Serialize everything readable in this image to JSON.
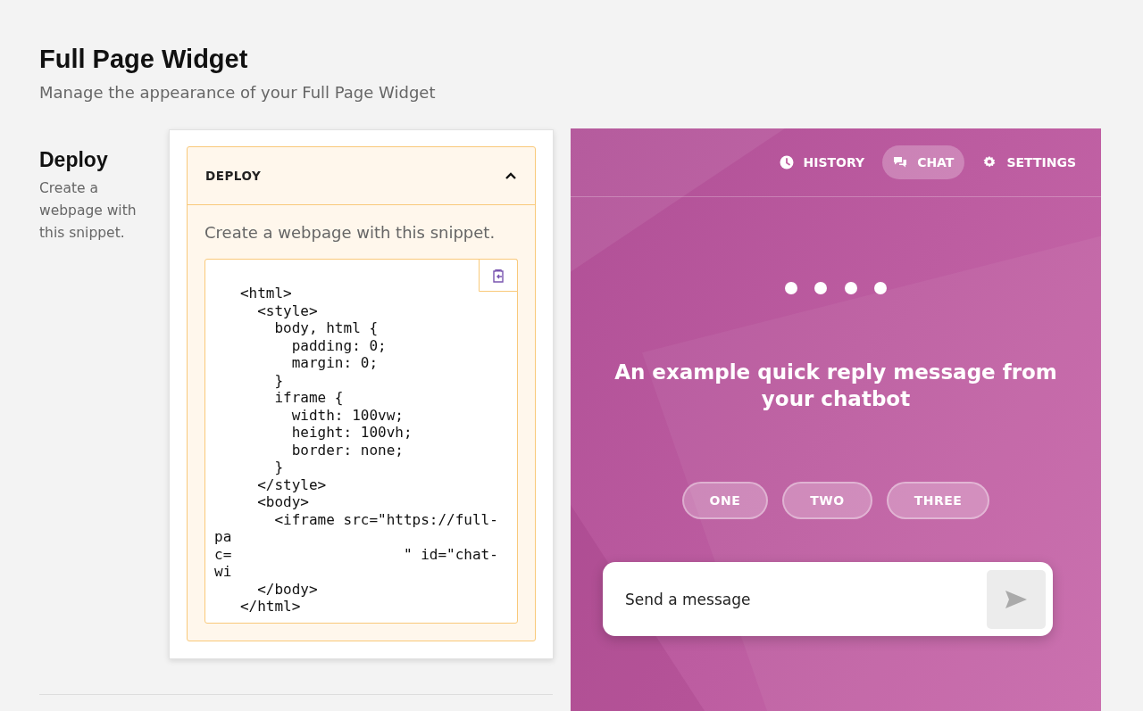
{
  "page": {
    "title": "Full Page Widget",
    "subtitle": "Manage the appearance of your Full Page Widget"
  },
  "section": {
    "title": "Deploy",
    "description": "Create a webpage with this snippet."
  },
  "accordion": {
    "title": "DEPLOY",
    "expanded": true,
    "description": "Create a webpage with this snippet.",
    "code_lines": [
      "   <html>",
      "     <style>",
      "       body, html {",
      "         padding: 0;",
      "         margin: 0;",
      "       }",
      "       iframe {",
      "         width: 100vw;",
      "         height: 100vh;",
      "         border: none;",
      "       }",
      "     </style>",
      "     <body>",
      "       <iframe src=\"https://full-",
      "pa",
      "c=                    \" id=\"chat-",
      "wi",
      "     </body>",
      "   </html>"
    ]
  },
  "preview": {
    "nav": [
      {
        "label": "HISTORY",
        "kind": "clock",
        "selected": false
      },
      {
        "label": "CHAT",
        "kind": "chat",
        "selected": true
      },
      {
        "label": "SETTINGS",
        "kind": "gear",
        "selected": false
      }
    ],
    "message": "An example quick reply message from your chatbot",
    "quick_replies": [
      "ONE",
      "TWO",
      "THREE"
    ],
    "input": {
      "placeholder": "Send a message"
    }
  }
}
